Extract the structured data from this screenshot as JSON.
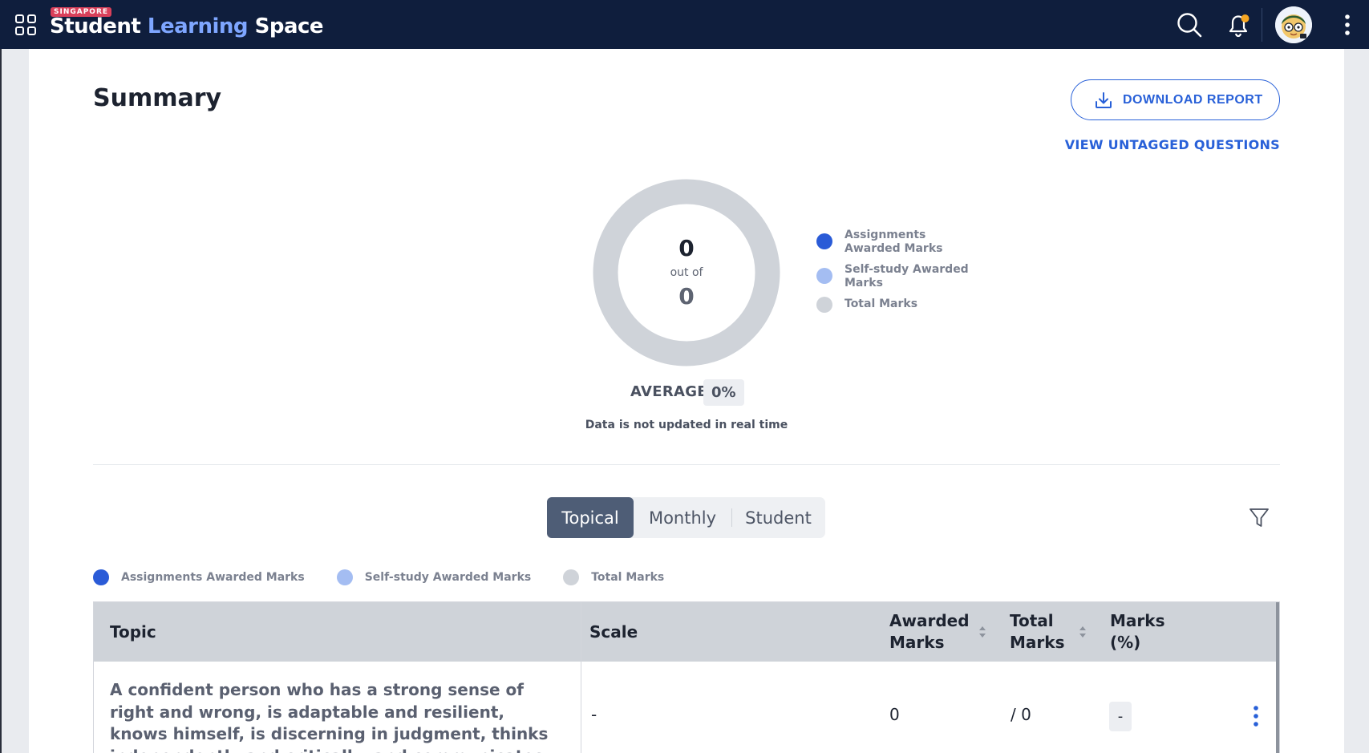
{
  "header": {
    "badge": "SINGAPORE",
    "brand_word1": "Student",
    "brand_word2": "Learning",
    "brand_word3": "Space",
    "icons": [
      "apps-grid-icon",
      "search-icon",
      "bell-icon",
      "avatar",
      "more-vertical-icon"
    ],
    "notification_dot_color": "#f5a623"
  },
  "summary": {
    "title": "Summary",
    "download_label": "DOWNLOAD REPORT",
    "untagged_label": "VIEW UNTAGGED QUESTIONS",
    "awarded_value": "0",
    "out_of_label": "out of",
    "total_value": "0",
    "average_label": "AVERAGE",
    "average_value": "0%",
    "note": "Data is not updated in real time"
  },
  "legend": [
    {
      "label": "Assignments Awarded Marks",
      "color": "#2a5bd7"
    },
    {
      "label": "Self-study Awarded Marks",
      "color": "#a4bdf2"
    },
    {
      "label": "Total Marks",
      "color": "#cfd3d9"
    }
  ],
  "tabs": [
    {
      "label": "Topical",
      "active": true
    },
    {
      "label": "Monthly",
      "active": false
    },
    {
      "label": "Student",
      "active": false
    }
  ],
  "table": {
    "columns": {
      "topic": "Topic",
      "scale": "Scale",
      "awarded_line1": "Awarded",
      "awarded_line2": "Marks",
      "total_line1": "Total",
      "total_line2": "Marks",
      "pct_line1": "Marks",
      "pct_line2": "(%)"
    },
    "rows": [
      {
        "topic": "A confident person who has a strong sense of right and wrong, is adaptable and resilient, knows himself, is discerning in judgment, thinks independently and critically, and communicates effectively",
        "scale": "-",
        "awarded": "0",
        "total": "/ 0",
        "pct": "-"
      }
    ]
  },
  "colors": {
    "topbar": "#0f1e3d",
    "accent": "#2860d8",
    "tab_active": "#4e5d76"
  }
}
